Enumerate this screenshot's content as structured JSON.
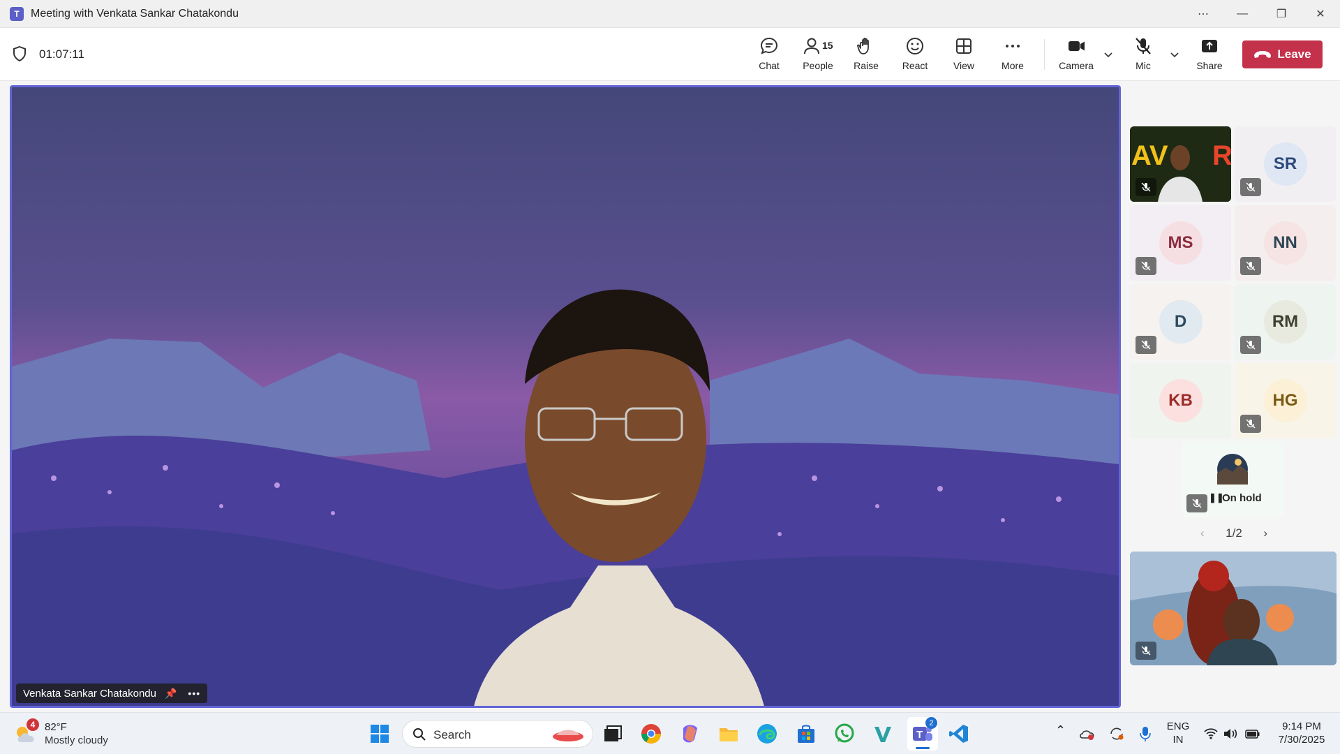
{
  "window": {
    "title": "Meeting with Venkata Sankar Chatakondu",
    "controls": [
      "more-options",
      "minimize",
      "restore",
      "close"
    ]
  },
  "toolbar": {
    "timer": "01:07:11",
    "chat_label": "Chat",
    "people_label": "People",
    "people_count": "15",
    "raise_label": "Raise",
    "react_label": "React",
    "view_label": "View",
    "more_label": "More",
    "camera_label": "Camera",
    "mic_label": "Mic",
    "share_label": "Share",
    "leave_label": "Leave",
    "leave_color": "#c4314b"
  },
  "stage": {
    "speaker_name": "Venkata Sankar Chatakondu",
    "highlight_color": "#6264d8"
  },
  "gallery": {
    "tiles": [
      {
        "initials": "",
        "type": "video",
        "muted": true
      },
      {
        "initials": "SR",
        "muted": true
      },
      {
        "initials": "MS",
        "muted": true
      },
      {
        "initials": "NN",
        "muted": true
      },
      {
        "initials": "D",
        "muted": true
      },
      {
        "initials": "RM",
        "muted": true
      },
      {
        "initials": "KB",
        "muted": false
      },
      {
        "initials": "HG",
        "muted": true
      }
    ],
    "on_hold_label": "On hold",
    "page": "1/2"
  },
  "taskbar": {
    "weather_badge": "4",
    "weather_temp": "82°F",
    "weather_desc": "Mostly cloudy",
    "search_placeholder": "Search",
    "teams_badge": "2",
    "lang_top": "ENG",
    "lang_bottom": "IN",
    "time": "9:14 PM",
    "date": "7/30/2025"
  }
}
